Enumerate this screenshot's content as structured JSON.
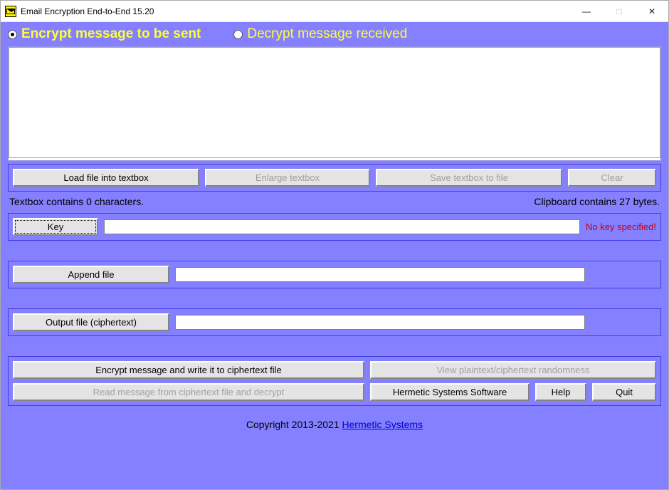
{
  "title": "Email Encryption End-to-End 15.20",
  "mode": {
    "encrypt_label": "Encrypt message to be sent",
    "decrypt_label": "Decrypt message received",
    "selected": "encrypt"
  },
  "textbox": {
    "value": ""
  },
  "textbox_buttons": {
    "load": "Load file into textbox",
    "enlarge": "Enlarge textbox",
    "save": "Save textbox to file",
    "clear": "Clear"
  },
  "status": {
    "textbox_chars_label": "Textbox contains 0 characters.",
    "clipboard_label": "Clipboard contains 27 bytes."
  },
  "key": {
    "button": "Key",
    "value": "",
    "warn": "No key specified!"
  },
  "append": {
    "button": "Append file",
    "value": ""
  },
  "output": {
    "button": "Output file (ciphertext)",
    "value": ""
  },
  "actions": {
    "encrypt": "Encrypt message and write it to ciphertext file",
    "view_random": "View plaintext/ciphertext randomness",
    "read_decrypt": "Read message from ciphertext file and decrypt",
    "hermetic": "Hermetic Systems Software",
    "help": "Help",
    "quit": "Quit"
  },
  "footer": {
    "copyright_prefix": "Copyright 2013-2021 ",
    "link_text": "Hermetic Systems"
  }
}
